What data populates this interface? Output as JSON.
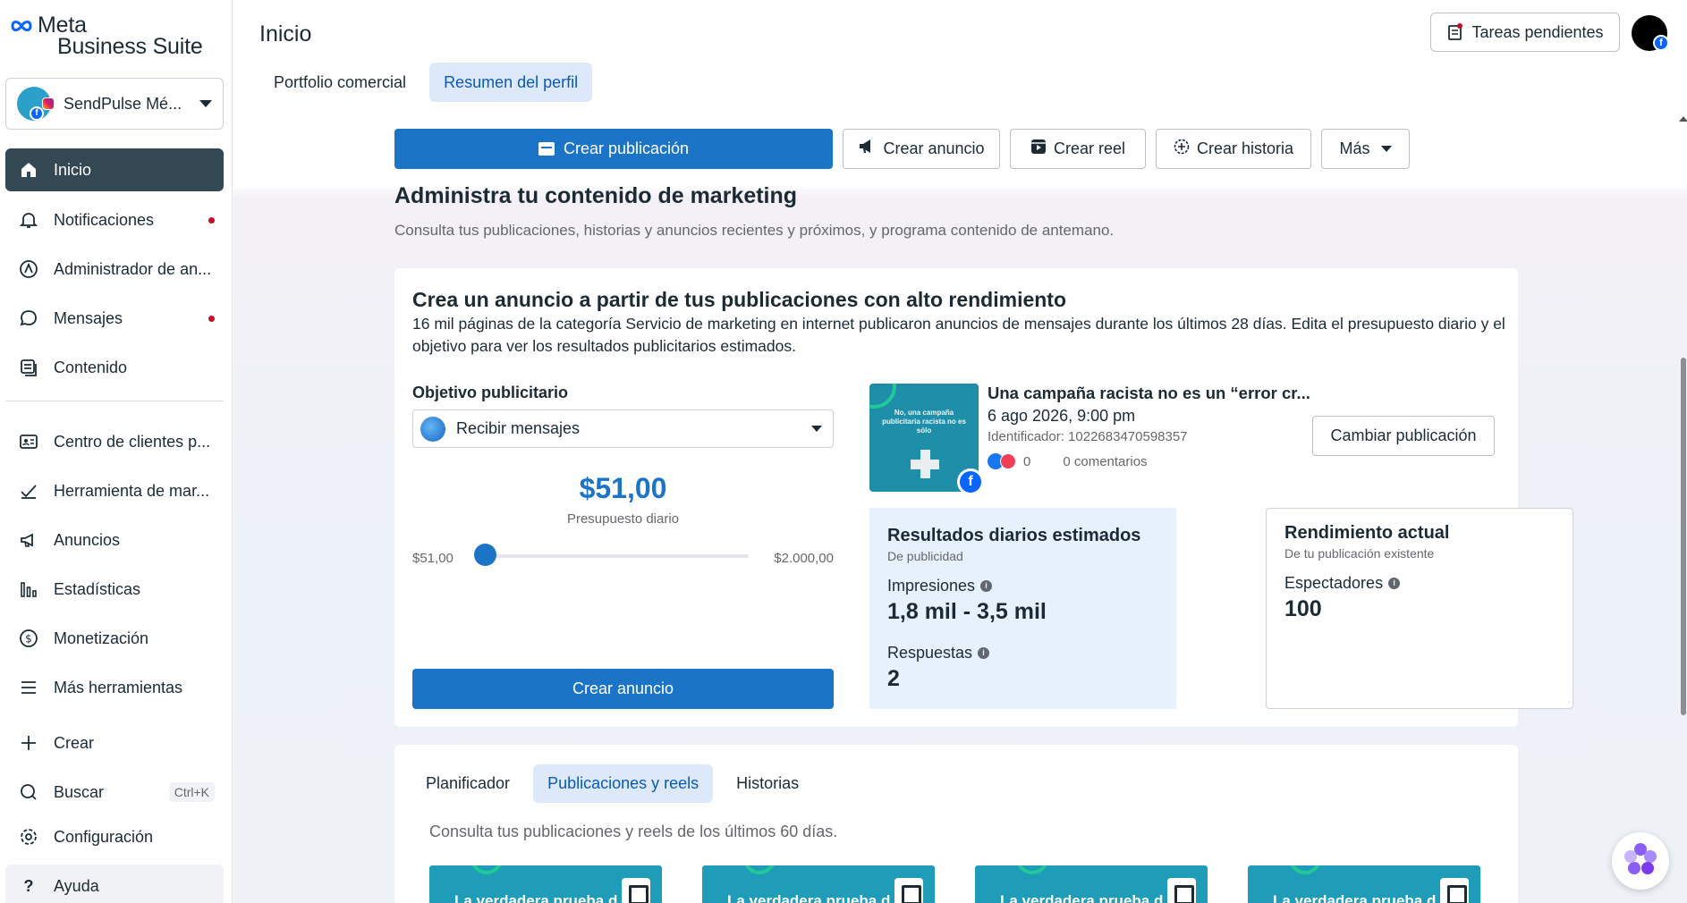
{
  "logo": {
    "brand": "Meta",
    "product": "Business Suite"
  },
  "account": {
    "name": "SendPulse Mé..."
  },
  "sidebar": {
    "items": [
      {
        "label": "Inicio",
        "icon": "home-icon",
        "active": true
      },
      {
        "label": "Notificaciones",
        "icon": "bell-icon",
        "dot": true
      },
      {
        "label": "Administrador de an...",
        "icon": "ads-manager-icon"
      },
      {
        "label": "Mensajes",
        "icon": "chat-icon",
        "dot": true
      },
      {
        "label": "Contenido",
        "icon": "content-icon"
      },
      {
        "label": "Centro de clientes p...",
        "icon": "contacts-icon"
      },
      {
        "label": "Herramienta de mar...",
        "icon": "tool-icon"
      },
      {
        "label": "Anuncios",
        "icon": "megaphone-icon"
      },
      {
        "label": "Estadísticas",
        "icon": "chart-icon"
      },
      {
        "label": "Monetización",
        "icon": "dollar-icon"
      },
      {
        "label": "Más herramientas",
        "icon": "menu-icon"
      },
      {
        "label": "Crear",
        "icon": "plus-icon"
      },
      {
        "label": "Buscar",
        "icon": "search-icon",
        "shortcut": "Ctrl+K"
      },
      {
        "label": "Configuración",
        "icon": "gear-icon"
      },
      {
        "label": "Ayuda",
        "icon": "help-icon"
      }
    ]
  },
  "header": {
    "title": "Inicio",
    "tabs": [
      "Portfolio comercial",
      "Resumen del perfil"
    ],
    "active_tab": "Resumen del perfil",
    "tasks_label": "Tareas pendientes"
  },
  "actions": {
    "create_post": "Crear publicación",
    "create_ad": "Crear anuncio",
    "create_reel": "Crear reel",
    "create_story": "Crear historia",
    "more": "Más"
  },
  "section": {
    "title": "Administra tu contenido de marketing",
    "subtitle": "Consulta tus publicaciones, historias y anuncios recientes y próximos, y programa contenido de antemano."
  },
  "ad_card": {
    "title": "Crea un anuncio a partir de tus publicaciones con alto rendimiento",
    "description": "16 mil páginas de la categoría Servicio de marketing en internet publicaron anuncios de mensajes durante los últimos 28 días. Edita el presupuesto diario y el objetivo para ver los resultados publicitarios estimados.",
    "objective_label": "Objetivo publicitario",
    "objective_value": "Recibir mensajes",
    "budget_amount": "$51,00",
    "budget_label": "Presupuesto diario",
    "slider_min": "$51,00",
    "slider_max": "$2.000,00",
    "slider_fraction": 0.0,
    "cta": "Crear anuncio",
    "post": {
      "thumb_text": "No, una campaña publicitaria racista no es sólo",
      "title": "Una campaña racista no es un “error cr...",
      "date": "6 ago 2026, 9:00 pm",
      "identifier": "Identificador: 1022683470598357",
      "reactions": "0",
      "comments": "0 comentarios",
      "change_button": "Cambiar publicación"
    },
    "estimated": {
      "title": "Resultados diarios estimados",
      "subtitle": "De publicidad",
      "impressions_label": "Impresiones",
      "impressions_value": "1,8 mil - 3,5 mil",
      "responses_label": "Respuestas",
      "responses_value": "2"
    },
    "performance": {
      "title": "Rendimiento actual",
      "subtitle": "De tu publicación existente",
      "viewers_label": "Espectadores",
      "viewers_value": "100"
    }
  },
  "posts_card": {
    "tabs": [
      "Planificador",
      "Publicaciones y reels",
      "Historias"
    ],
    "active_tab": "Publicaciones y reels",
    "subtitle": "Consulta tus publicaciones y reels de los últimos 60 días.",
    "thumbs": [
      {
        "text": "La verdadera prueba d"
      },
      {
        "text": "La verdadera prueba d"
      },
      {
        "text": "La verdadera prueba d"
      },
      {
        "text": "La verdadera prueba d"
      }
    ]
  },
  "colors": {
    "primary": "#1b74c5",
    "active_nav": "#344854",
    "notification_dot": "#c80a28"
  }
}
